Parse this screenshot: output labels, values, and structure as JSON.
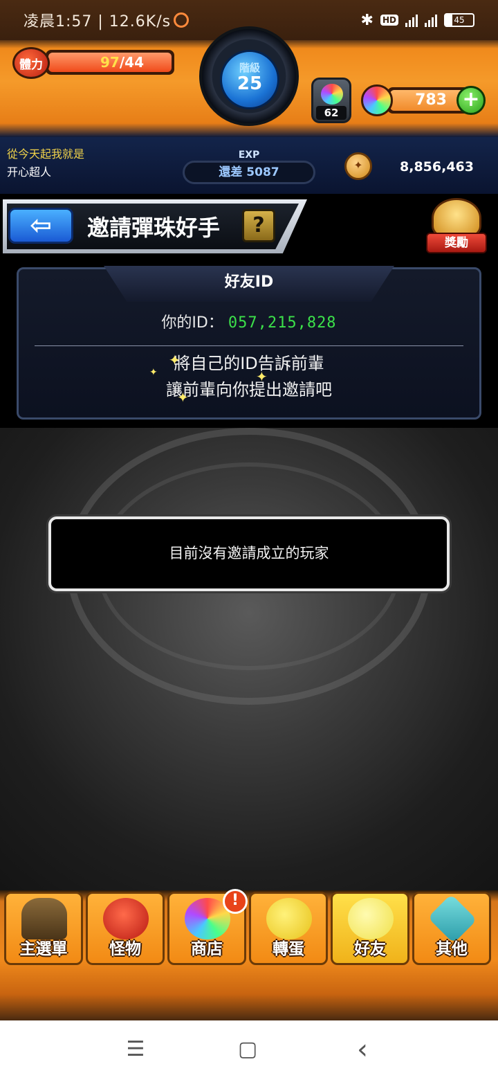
{
  "status_bar": {
    "time": "凌晨1:57 | 12.6K/s",
    "bluetooth_icon": "bluetooth-icon",
    "hd_badge": "HD",
    "network": "4G",
    "battery": "45"
  },
  "header": {
    "stamina_label": "體力",
    "stamina_current": "97",
    "stamina_max": "/44",
    "rank_label": "階級",
    "rank_value": "25",
    "exp_label": "EXP",
    "exp_remaining": "還差 5087",
    "egg_count": "62",
    "orb_count": "783",
    "plus_label": "+",
    "motto_line1": "從今天起我就是",
    "motto_line2": "开心超人",
    "gold": "8,856,463"
  },
  "titlebar": {
    "back_label": "⇦",
    "title": "邀請彈珠好手",
    "help_label": "?",
    "reward_label": "獎勵"
  },
  "friend_panel": {
    "tab_title": "好友ID",
    "id_label": "你的ID：",
    "id_value": "057,215,828",
    "hint_line1": "將自己的ID告訴前輩",
    "hint_line2": "讓前輩向你提出邀請吧"
  },
  "main": {
    "status_message": "目前沒有邀請成立的玩家"
  },
  "bottom_nav": {
    "items": [
      {
        "label": "主選單",
        "icon": "gate-icon"
      },
      {
        "label": "怪物",
        "icon": "monster-icon"
      },
      {
        "label": "商店",
        "icon": "rainbow-orb-icon"
      },
      {
        "label": "轉蛋",
        "icon": "egg-icon"
      },
      {
        "label": "好友",
        "icon": "friends-icon"
      },
      {
        "label": "其他",
        "icon": "question-diamond-icon"
      }
    ],
    "shop_alert": "!"
  },
  "system_nav": {
    "menu": "☰",
    "home": "▢",
    "back": "‹"
  },
  "colors": {
    "header_orange": "#f59a2a",
    "header_navy": "#0b1633",
    "id_green": "#3ce04a",
    "bar_red": "#f04a1a",
    "nav_orange": "#f28a14"
  }
}
